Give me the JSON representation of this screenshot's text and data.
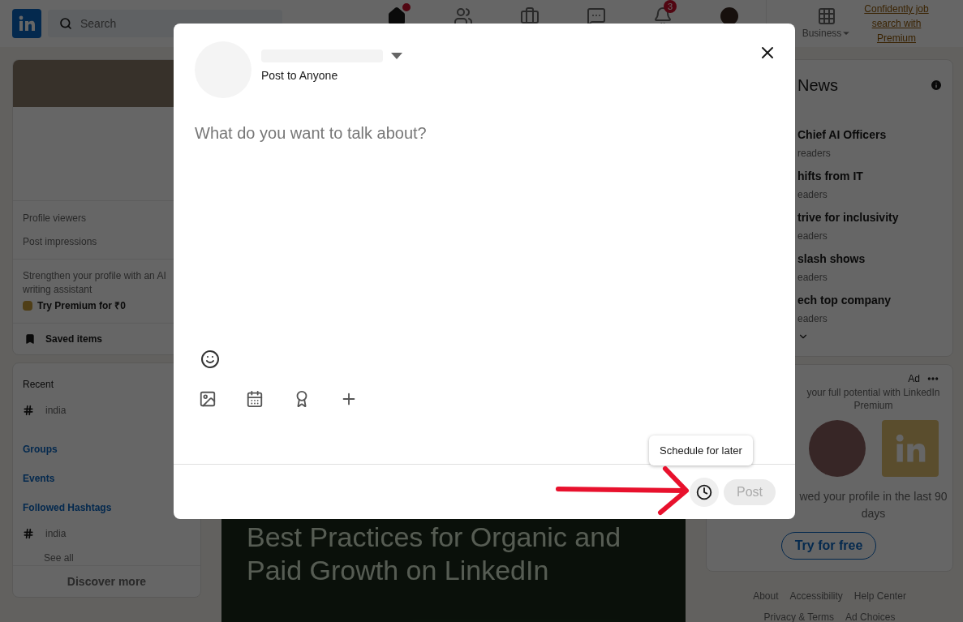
{
  "header": {
    "search": {
      "placeholder": "Search"
    },
    "nav": [
      {
        "kind": "home",
        "selected": true,
        "dot": true
      },
      {
        "kind": "network",
        "selected": false,
        "dot": false
      },
      {
        "kind": "jobs",
        "selected": false,
        "dot": false
      },
      {
        "kind": "messaging",
        "selected": false,
        "dot": false
      },
      {
        "kind": "notifications",
        "selected": false,
        "dot": false,
        "badge": "3"
      },
      {
        "kind": "me",
        "selected": false,
        "dot": false
      }
    ],
    "work": {
      "label": "Business"
    },
    "premium_link": "Confidently job search with Premium"
  },
  "left": {
    "stats": [
      "Profile viewers",
      "Post impressions"
    ],
    "promo": {
      "text": "Strengthen your profile with an AI writing assistant",
      "link": "Try Premium for ₹0"
    },
    "saved": "Saved items",
    "recent_title": "Recent",
    "recent": [
      "india"
    ],
    "links": [
      "Groups",
      "Events",
      "Followed Hashtags"
    ],
    "hashtags": [
      "india"
    ],
    "see_all": "See all",
    "discover": "Discover more"
  },
  "feed": {
    "headline": "Best Practices for Organic and Paid Growth on LinkedIn"
  },
  "right": {
    "news_title": "News",
    "news": [
      {
        "title": "Chief AI Officers",
        "subtitle": "readers"
      },
      {
        "title": "hifts from IT",
        "subtitle": "eaders"
      },
      {
        "title": "trive for inclusivity",
        "subtitle": "eaders"
      },
      {
        "title": "slash shows",
        "subtitle": "eaders"
      },
      {
        "title": "ech top company",
        "subtitle": "eaders"
      }
    ],
    "ad": {
      "label": "Ad",
      "text": "your full potential with LinkedIn Premium",
      "message": "wed your profile in the last 90 days",
      "button": "Try for free"
    },
    "footer": [
      [
        "About",
        "Accessibility",
        "Help Center"
      ],
      [
        "Privacy & Terms",
        "Ad Choices"
      ]
    ]
  },
  "modal": {
    "audience": "Post to Anyone",
    "placeholder": "What do you want to talk about?",
    "tools": [
      {
        "kind": "image"
      },
      {
        "kind": "event"
      },
      {
        "kind": "celebrate"
      },
      {
        "kind": "more"
      }
    ],
    "tooltip": "Schedule for later",
    "post_button": {
      "label": "Post",
      "disabled": true
    }
  }
}
